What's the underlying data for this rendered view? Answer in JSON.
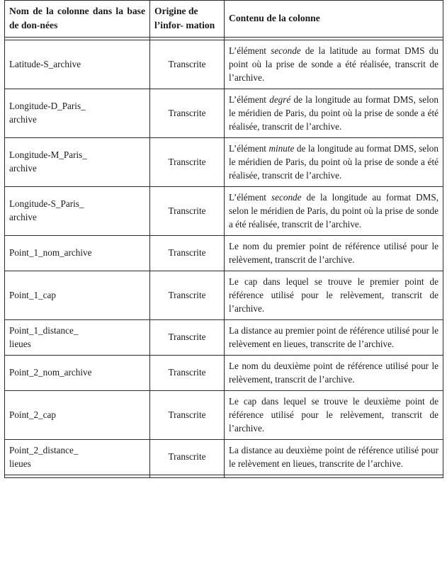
{
  "table": {
    "headers": {
      "column_name": "Nom de la colonne dans la base de don-­nées",
      "origin": "Origine de l’infor-\nmation",
      "content": "Contenu de la colonne"
    },
    "rows": [
      {
        "name": "Latitude-S_archive",
        "origin": "Transcrite",
        "content_pre": "L’élément ",
        "content_em": "seconde",
        "content_post": " de la latitude au format DMS du point où la prise de sonde a été réalisée, transcrit de l’archive."
      },
      {
        "name": "Longitude-D_Paris_\narchive",
        "origin": "Transcrite",
        "content_pre": "L’élément ",
        "content_em": "degré",
        "content_post": " de la longitude au format DMS, selon le méridien de Paris, du point où la prise de sonde a été réalisée, transcrit de l’archive."
      },
      {
        "name": "Longitude-M_Paris_\narchive",
        "origin": "Transcrite",
        "content_pre": "L’élément ",
        "content_em": "minute",
        "content_post": " de la longitude au format DMS, selon le méridien de Paris, du point où la prise de sonde a été réalisée, transcrit de l’archive."
      },
      {
        "name": "Longitude-S_Paris_\narchive",
        "origin": "Transcrite",
        "content_pre": "L’élément ",
        "content_em": "seconde",
        "content_post": " de la longitude au format DMS, selon le méridien de Paris, du point où la prise de sonde a été réalisée, transcrit de l’archive."
      },
      {
        "name": "Point_1_nom_archive",
        "origin": "Transcrite",
        "content_pre": "Le nom du premier point de référence utilisé pour le relèvement, transcrit de l’archive.",
        "content_em": "",
        "content_post": ""
      },
      {
        "name": "Point_1_cap",
        "origin": "Transcrite",
        "content_pre": "Le cap dans lequel se trouve le premier point de référence utilisé pour le relèvement, transcrit de l’archive.",
        "content_em": "",
        "content_post": ""
      },
      {
        "name": "Point_1_distance_\nlieues",
        "origin": "Transcrite",
        "content_pre": "La distance au premier point de référence utilisé pour le relèvement en lieues, transcrite de l’archive.",
        "content_em": "",
        "content_post": ""
      },
      {
        "name": "Point_2_nom_archive",
        "origin": "Transcrite",
        "content_pre": "Le nom du deuxième point de référence utilisé pour le relèvement, transcrit de l’archive.",
        "content_em": "",
        "content_post": ""
      },
      {
        "name": "Point_2_cap",
        "origin": "Transcrite",
        "content_pre": "Le cap dans lequel se trouve le deuxième point de référence utilisé pour le relèvement, transcrit de l’archive.",
        "content_em": "",
        "content_post": ""
      },
      {
        "name": "Point_2_distance_\nlieues",
        "origin": "Transcrite",
        "content_pre": "La distance au deuxième point de référence utilisé pour le relèvement en lieues, transcrite de l’archive.",
        "content_em": "",
        "content_post": ""
      }
    ]
  }
}
